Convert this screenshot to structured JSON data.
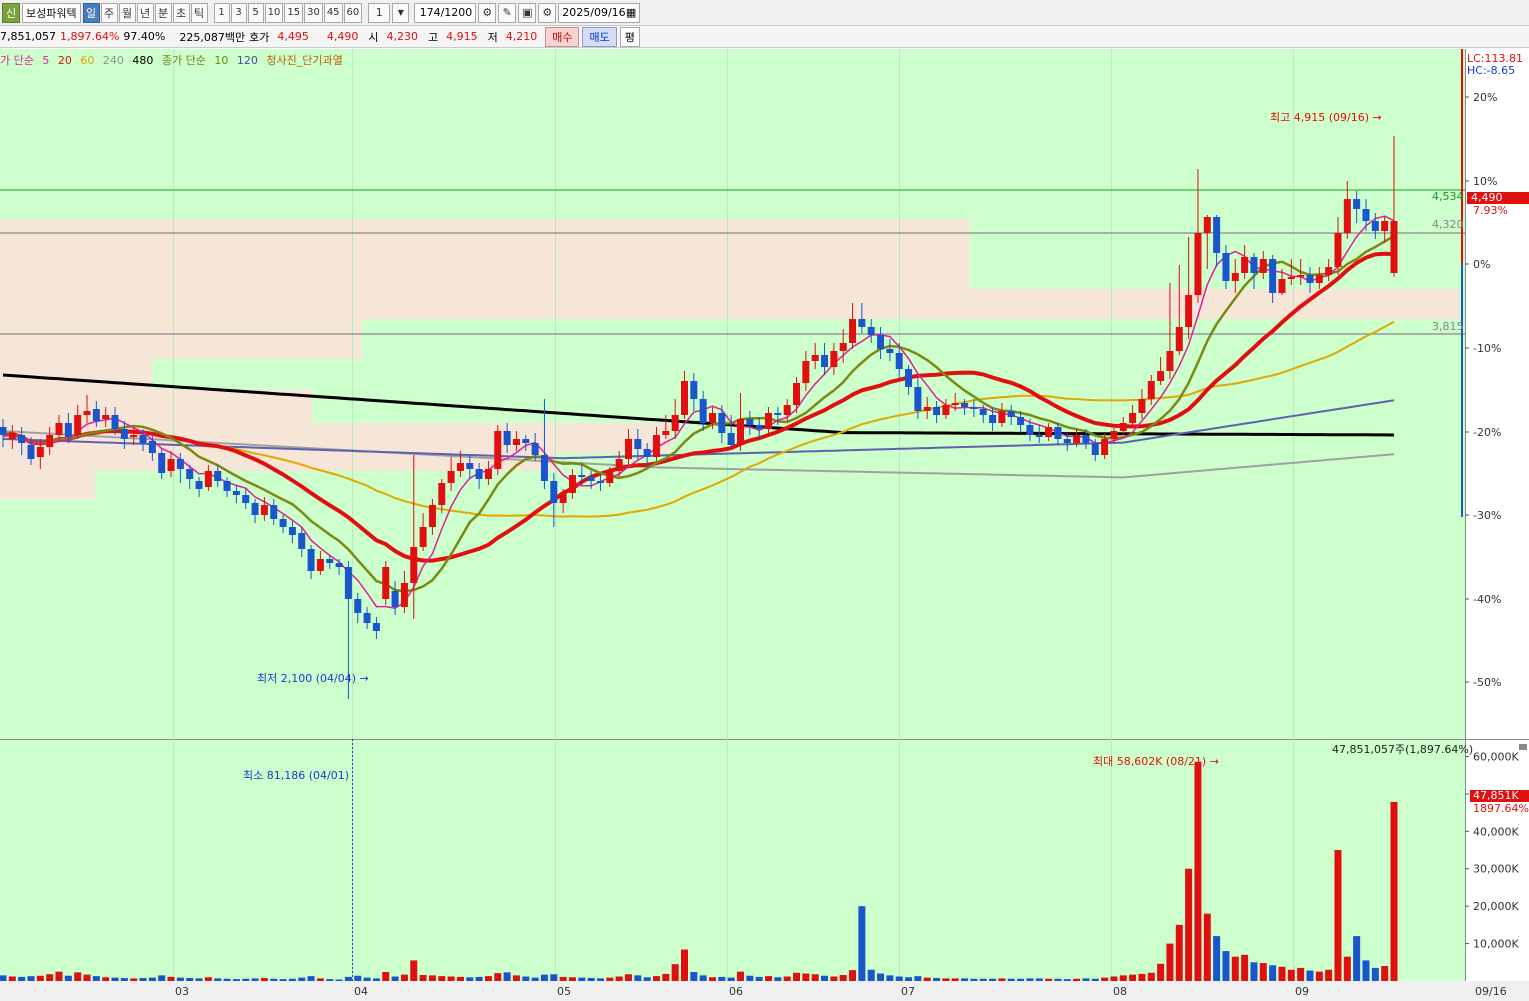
{
  "toolbar": {
    "logo": "신",
    "stock_name": "보성파워텍",
    "periods": [
      "일",
      "주",
      "월",
      "년",
      "분",
      "초",
      "틱"
    ],
    "active_period": "일",
    "intervals": [
      "1",
      "3",
      "5",
      "10",
      "15",
      "30",
      "45",
      "60"
    ],
    "unit_value": "1",
    "count": "174/1200",
    "date": "2025/09/16"
  },
  "info": {
    "volume": "7,851,057",
    "volume_change": "1,897.64%",
    "ratio": "97.40%",
    "amount": "225,087백만",
    "hoga_label": "호가",
    "ask": "4,495",
    "bid": "4,490",
    "open_label": "시",
    "open": "4,230",
    "high_label": "고",
    "high": "4,915",
    "low_label": "저",
    "low": "4,210",
    "buy_label": "매수",
    "sell_label": "매도",
    "eval_label": "평"
  },
  "legend": {
    "price_prefix": "가 단순",
    "ma_5": "5",
    "ma_20": "20",
    "ma_60": "60",
    "ma_240": "240",
    "ma_480": "480",
    "vol_prefix": "종가 단순",
    "vol_10": "10",
    "vol_120": "120",
    "indicator": "청사진_단기과열",
    "colors": {
      "ma5": "#e0209a",
      "ma20": "#e01010",
      "ma60": "#e0a000",
      "ma240": "#909090",
      "ma480": "#000000",
      "vol10": "#6a8a10",
      "vol120": "#4a4aa0",
      "indicator": "#c06000"
    }
  },
  "annotations": {
    "high": "최고 4,915 (09/16)",
    "low": "최저 2,100 (04/04)",
    "vol_max": "최대 58,602K (08/21)",
    "vol_min": "최소 81,186 (04/01)",
    "vol_total": "47,851,057주(1,897.64%)"
  },
  "right_axis": {
    "lc": "LC:113.81",
    "hc": "HC:-8.65",
    "pct_ticks": [
      "20%",
      "10%",
      "0%",
      "-10%",
      "-20%",
      "-30%",
      "-40%",
      "-50%"
    ],
    "current_price": "4,490",
    "current_pct": "7.93%",
    "level_4534": "4,534",
    "level_4320": "4,320",
    "level_3815": "3,815",
    "vol_ticks": [
      "60,000K",
      "50,000K",
      "40,000K",
      "30,000K",
      "20,000K",
      "10,000K"
    ],
    "vol_current": "47,851K",
    "vol_current_pct": "1897.64%"
  },
  "x_axis": {
    "months": [
      "03",
      "04",
      "05",
      "06",
      "07",
      "08",
      "09"
    ],
    "last": "09/16"
  },
  "chart_data": {
    "type": "candlestick",
    "price_range": [
      1900,
      5300
    ],
    "volume_range": [
      0,
      62000
    ],
    "candles": [
      [
        3460,
        3420,
        3500,
        3360,
        1500
      ],
      [
        3400,
        3430,
        3470,
        3350,
        1200
      ],
      [
        3420,
        3380,
        3460,
        3320,
        1100
      ],
      [
        3370,
        3300,
        3410,
        3270,
        1300
      ],
      [
        3310,
        3360,
        3400,
        3250,
        1400
      ],
      [
        3360,
        3420,
        3460,
        3320,
        1800
      ],
      [
        3420,
        3480,
        3520,
        3390,
        2500
      ],
      [
        3480,
        3410,
        3530,
        3380,
        1400
      ],
      [
        3420,
        3520,
        3570,
        3400,
        2300
      ],
      [
        3520,
        3540,
        3620,
        3480,
        1700
      ],
      [
        3550,
        3490,
        3590,
        3460,
        1300
      ],
      [
        3500,
        3520,
        3560,
        3460,
        1000
      ],
      [
        3520,
        3450,
        3560,
        3420,
        900
      ],
      [
        3450,
        3400,
        3490,
        3350,
        800
      ],
      [
        3410,
        3420,
        3460,
        3370,
        700
      ],
      [
        3420,
        3380,
        3450,
        3340,
        800
      ],
      [
        3390,
        3330,
        3420,
        3290,
        900
      ],
      [
        3330,
        3230,
        3350,
        3200,
        1500
      ],
      [
        3240,
        3300,
        3340,
        3210,
        1100
      ],
      [
        3300,
        3250,
        3330,
        3180,
        900
      ],
      [
        3250,
        3200,
        3270,
        3150,
        800
      ],
      [
        3190,
        3150,
        3210,
        3110,
        700
      ],
      [
        3160,
        3240,
        3270,
        3140,
        1000
      ],
      [
        3240,
        3190,
        3270,
        3160,
        700
      ],
      [
        3190,
        3140,
        3210,
        3110,
        600
      ],
      [
        3140,
        3120,
        3170,
        3080,
        500
      ],
      [
        3120,
        3080,
        3150,
        3050,
        600
      ],
      [
        3080,
        3020,
        3100,
        2980,
        700
      ],
      [
        3020,
        3070,
        3110,
        2990,
        800
      ],
      [
        3070,
        3000,
        3100,
        2970,
        600
      ],
      [
        3000,
        2960,
        3020,
        2930,
        500
      ],
      [
        2960,
        2920,
        2990,
        2880,
        600
      ],
      [
        2930,
        2850,
        2960,
        2810,
        900
      ],
      [
        2850,
        2740,
        2870,
        2700,
        1300
      ],
      [
        2740,
        2800,
        2840,
        2720,
        700
      ],
      [
        2800,
        2780,
        2820,
        2750,
        500
      ],
      [
        2780,
        2760,
        2800,
        2720,
        400
      ],
      [
        2760,
        2600,
        2790,
        2100,
        1100
      ],
      [
        2600,
        2530,
        2630,
        2480,
        1400
      ],
      [
        2530,
        2480,
        2560,
        2450,
        900
      ],
      [
        2480,
        2440,
        2510,
        2400,
        700
      ],
      [
        2600,
        2760,
        2790,
        2570,
        2400
      ],
      [
        2640,
        2560,
        2690,
        2520,
        1200
      ],
      [
        2560,
        2680,
        2740,
        2530,
        1700
      ],
      [
        2680,
        2860,
        3320,
        2500,
        5500
      ],
      [
        2860,
        2960,
        3030,
        2840,
        1600
      ],
      [
        2960,
        3070,
        3100,
        2920,
        1500
      ],
      [
        3070,
        3180,
        3200,
        3030,
        1300
      ],
      [
        3180,
        3240,
        3310,
        3140,
        1200
      ],
      [
        3240,
        3280,
        3340,
        3210,
        1100
      ],
      [
        3280,
        3250,
        3320,
        3200,
        1000
      ],
      [
        3250,
        3200,
        3280,
        3150,
        1100
      ],
      [
        3200,
        3250,
        3290,
        3170,
        1300
      ],
      [
        3250,
        3440,
        3470,
        3220,
        2100
      ],
      [
        3440,
        3370,
        3480,
        3330,
        2300
      ],
      [
        3370,
        3400,
        3440,
        3340,
        1500
      ],
      [
        3400,
        3380,
        3420,
        3340,
        1200
      ],
      [
        3380,
        3320,
        3430,
        3290,
        900
      ],
      [
        3320,
        3190,
        3600,
        3150,
        1700
      ],
      [
        3190,
        3080,
        3230,
        2960,
        1800
      ],
      [
        3080,
        3130,
        3150,
        3030,
        1100
      ],
      [
        3130,
        3220,
        3250,
        3100,
        1000
      ],
      [
        3220,
        3210,
        3280,
        3170,
        900
      ],
      [
        3210,
        3190,
        3240,
        3150,
        800
      ],
      [
        3190,
        3180,
        3220,
        3140,
        700
      ],
      [
        3180,
        3240,
        3260,
        3160,
        900
      ],
      [
        3240,
        3300,
        3340,
        3210,
        1200
      ],
      [
        3300,
        3400,
        3450,
        3270,
        1800
      ],
      [
        3400,
        3350,
        3450,
        3300,
        1500
      ],
      [
        3350,
        3310,
        3380,
        3260,
        1000
      ],
      [
        3310,
        3420,
        3460,
        3290,
        1300
      ],
      [
        3420,
        3440,
        3520,
        3400,
        1900
      ],
      [
        3440,
        3520,
        3600,
        3400,
        4500
      ],
      [
        3520,
        3690,
        3740,
        3500,
        8400
      ],
      [
        3690,
        3600,
        3730,
        3540,
        2400
      ],
      [
        3600,
        3480,
        3640,
        3440,
        1500
      ],
      [
        3480,
        3530,
        3560,
        3450,
        1000
      ],
      [
        3530,
        3430,
        3570,
        3380,
        1100
      ],
      [
        3430,
        3370,
        3520,
        3360,
        900
      ],
      [
        3370,
        3500,
        3630,
        3340,
        2500
      ],
      [
        3500,
        3470,
        3540,
        3420,
        1400
      ],
      [
        3470,
        3450,
        3510,
        3400,
        1100
      ],
      [
        3450,
        3530,
        3560,
        3410,
        1300
      ],
      [
        3530,
        3520,
        3560,
        3470,
        1000
      ],
      [
        3520,
        3570,
        3600,
        3490,
        1200
      ],
      [
        3570,
        3680,
        3710,
        3530,
        2200
      ],
      [
        3680,
        3790,
        3840,
        3640,
        2000
      ],
      [
        3790,
        3820,
        3880,
        3750,
        1800
      ],
      [
        3820,
        3760,
        3880,
        3720,
        1400
      ],
      [
        3760,
        3840,
        3880,
        3720,
        1200
      ],
      [
        3840,
        3880,
        3950,
        3780,
        1600
      ],
      [
        3880,
        4000,
        4080,
        3850,
        2900
      ],
      [
        4000,
        3960,
        4080,
        3930,
        20000
      ],
      [
        3960,
        3920,
        4000,
        3880,
        3000
      ],
      [
        3920,
        3850,
        3960,
        3800,
        2000
      ],
      [
        3850,
        3830,
        3900,
        3790,
        1500
      ],
      [
        3830,
        3750,
        3880,
        3700,
        1200
      ],
      [
        3750,
        3660,
        3770,
        3620,
        1000
      ],
      [
        3660,
        3540,
        3710,
        3500,
        1300
      ],
      [
        3540,
        3560,
        3610,
        3500,
        900
      ],
      [
        3560,
        3520,
        3590,
        3480,
        800
      ],
      [
        3520,
        3570,
        3600,
        3500,
        700
      ],
      [
        3570,
        3580,
        3630,
        3540,
        700
      ],
      [
        3580,
        3560,
        3600,
        3520,
        700
      ],
      [
        3560,
        3550,
        3600,
        3510,
        600
      ],
      [
        3550,
        3520,
        3570,
        3480,
        600
      ],
      [
        3520,
        3480,
        3560,
        3440,
        600
      ],
      [
        3480,
        3540,
        3580,
        3460,
        700
      ],
      [
        3540,
        3510,
        3570,
        3470,
        600
      ],
      [
        3510,
        3470,
        3540,
        3430,
        600
      ],
      [
        3470,
        3420,
        3500,
        3390,
        700
      ],
      [
        3420,
        3410,
        3470,
        3380,
        700
      ],
      [
        3410,
        3460,
        3480,
        3390,
        600
      ],
      [
        3460,
        3400,
        3480,
        3370,
        600
      ],
      [
        3400,
        3380,
        3430,
        3340,
        500
      ],
      [
        3380,
        3420,
        3450,
        3360,
        600
      ],
      [
        3420,
        3380,
        3450,
        3350,
        700
      ],
      [
        3380,
        3320,
        3400,
        3290,
        600
      ],
      [
        3320,
        3400,
        3430,
        3300,
        900
      ],
      [
        3400,
        3440,
        3470,
        3380,
        1200
      ],
      [
        3440,
        3480,
        3510,
        3420,
        1500
      ],
      [
        3480,
        3530,
        3570,
        3460,
        1700
      ],
      [
        3530,
        3600,
        3650,
        3500,
        1900
      ],
      [
        3600,
        3690,
        3720,
        3570,
        2200
      ],
      [
        3690,
        3740,
        3810,
        3670,
        4600
      ],
      [
        3740,
        3840,
        4180,
        3700,
        10000
      ],
      [
        3840,
        3960,
        4270,
        3820,
        15000
      ],
      [
        3960,
        4120,
        4410,
        3900,
        30000
      ],
      [
        4120,
        4430,
        4750,
        4080,
        58602
      ],
      [
        4430,
        4510,
        4520,
        4250,
        18000
      ],
      [
        4510,
        4330,
        4520,
        4260,
        12000
      ],
      [
        4330,
        4190,
        4370,
        4150,
        8000
      ],
      [
        4190,
        4230,
        4300,
        4130,
        6500
      ],
      [
        4230,
        4310,
        4370,
        4200,
        7000
      ],
      [
        4310,
        4230,
        4330,
        4150,
        5000
      ],
      [
        4230,
        4300,
        4340,
        4200,
        4800
      ],
      [
        4300,
        4130,
        4320,
        4080,
        4200
      ],
      [
        4130,
        4200,
        4250,
        4120,
        3800
      ],
      [
        4200,
        4210,
        4300,
        4170,
        3000
      ],
      [
        4210,
        4220,
        4300,
        4170,
        3500
      ],
      [
        4220,
        4180,
        4260,
        4130,
        2800
      ],
      [
        4180,
        4220,
        4260,
        4150,
        2500
      ],
      [
        4220,
        4260,
        4300,
        4190,
        3000
      ],
      [
        4260,
        4430,
        4510,
        4220,
        35000
      ],
      [
        4430,
        4600,
        4690,
        4400,
        6500
      ],
      [
        4600,
        4550,
        4640,
        4480,
        12000
      ],
      [
        4550,
        4490,
        4600,
        4440,
        5500
      ],
      [
        4490,
        4440,
        4530,
        4400,
        3500
      ],
      [
        4440,
        4490,
        4510,
        4380,
        4000
      ],
      [
        4230,
        4490,
        4915,
        4210,
        47851
      ]
    ]
  }
}
